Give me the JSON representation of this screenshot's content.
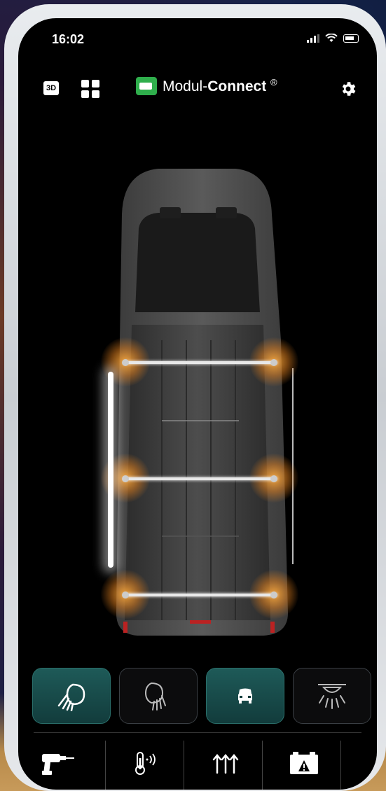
{
  "status_bar": {
    "time": "16:02"
  },
  "header": {
    "view_toggle_label": "3D",
    "brand_name_light": "Modul-",
    "brand_name_bold": "Connect",
    "brand_trademark": "®"
  },
  "lighting": {
    "roof_rails": 3,
    "side_light": "on",
    "glow_color": "#ff9a2e"
  },
  "controls": {
    "buttons": [
      {
        "icon": "low-beam-headlight-icon",
        "active": true
      },
      {
        "icon": "high-beam-headlight-icon",
        "active": false
      },
      {
        "icon": "vehicle-front-icon",
        "active": true
      },
      {
        "icon": "ceiling-light-icon",
        "active": false
      }
    ]
  },
  "tabbar": {
    "items": [
      {
        "icon": "drill-icon"
      },
      {
        "icon": "thermometer-signal-icon"
      },
      {
        "icon": "arrows-up-icon"
      },
      {
        "icon": "battery-warning-icon"
      }
    ]
  },
  "colors": {
    "active_button": "#1e5a58",
    "brand_logo": "#2fae4c"
  }
}
